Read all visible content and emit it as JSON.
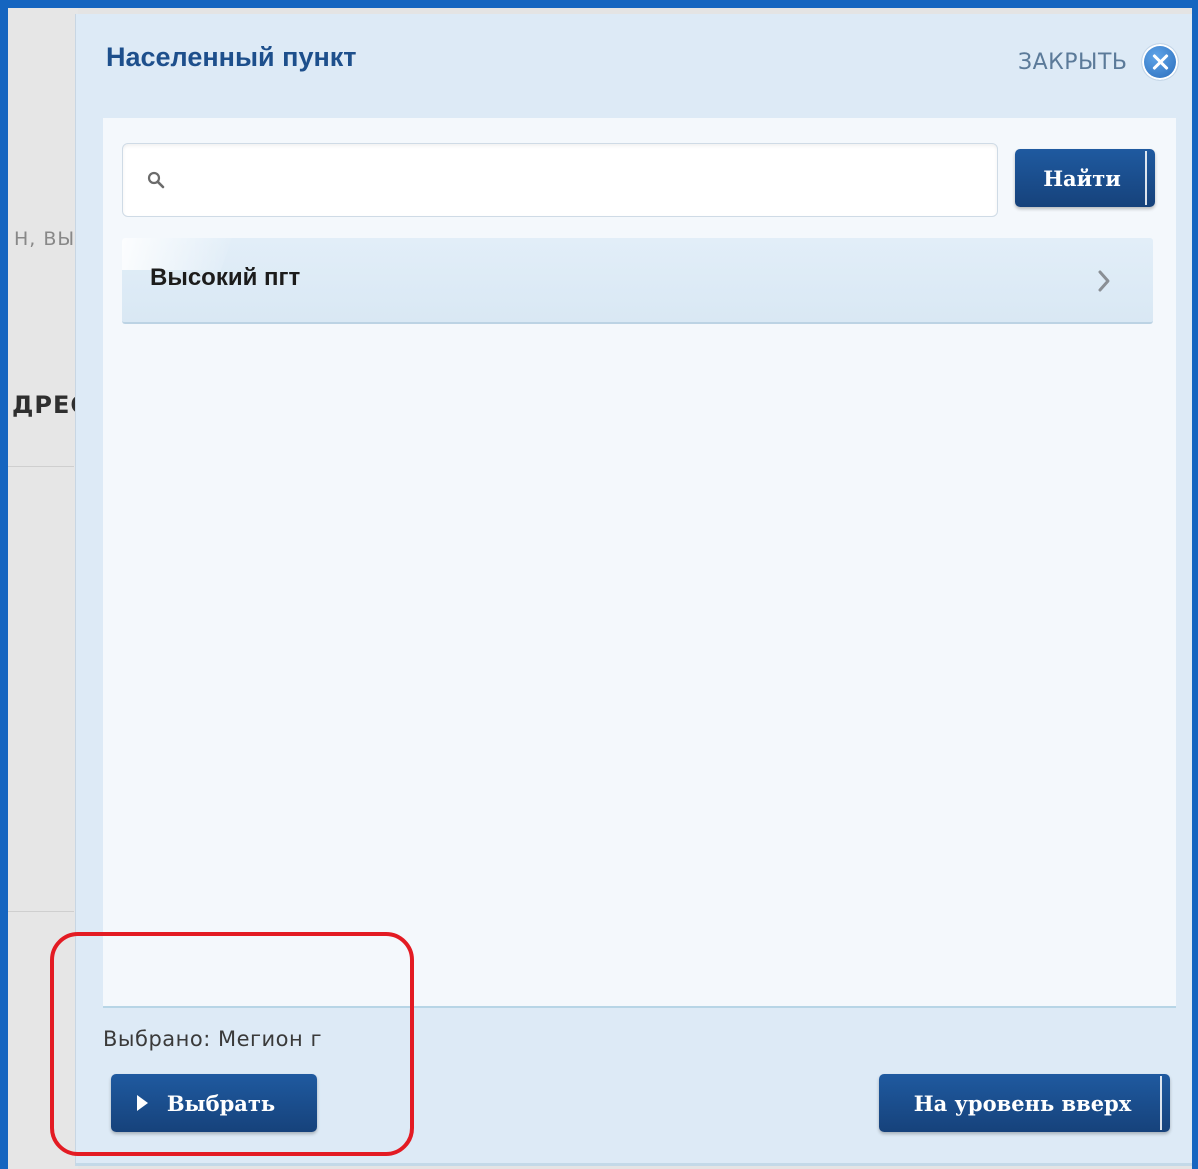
{
  "background": {
    "partial_text_1": "Н, ВЫ",
    "partial_text_2": "ДРЕС"
  },
  "dialog": {
    "title": "Населенный пункт",
    "close_label": "ЗАКРЫТЬ"
  },
  "search": {
    "value": "",
    "placeholder": "",
    "button_label": "Найти"
  },
  "list": {
    "items": [
      {
        "label": "Высокий пгт"
      }
    ]
  },
  "footer": {
    "selected_text": "Выбрано: Мегион г",
    "select_button_label": "Выбрать",
    "up_button_label": "На уровень вверх"
  },
  "colors": {
    "frame_border": "#1565c0",
    "dialog_background": "#ddeaf6",
    "title": "#1d4f8c",
    "button": "#1a4d8f",
    "annotation": "#e31b23"
  },
  "icons": {
    "search": "search-icon",
    "close": "close-icon",
    "chevron": "chevron-right-icon",
    "play": "play-icon"
  }
}
